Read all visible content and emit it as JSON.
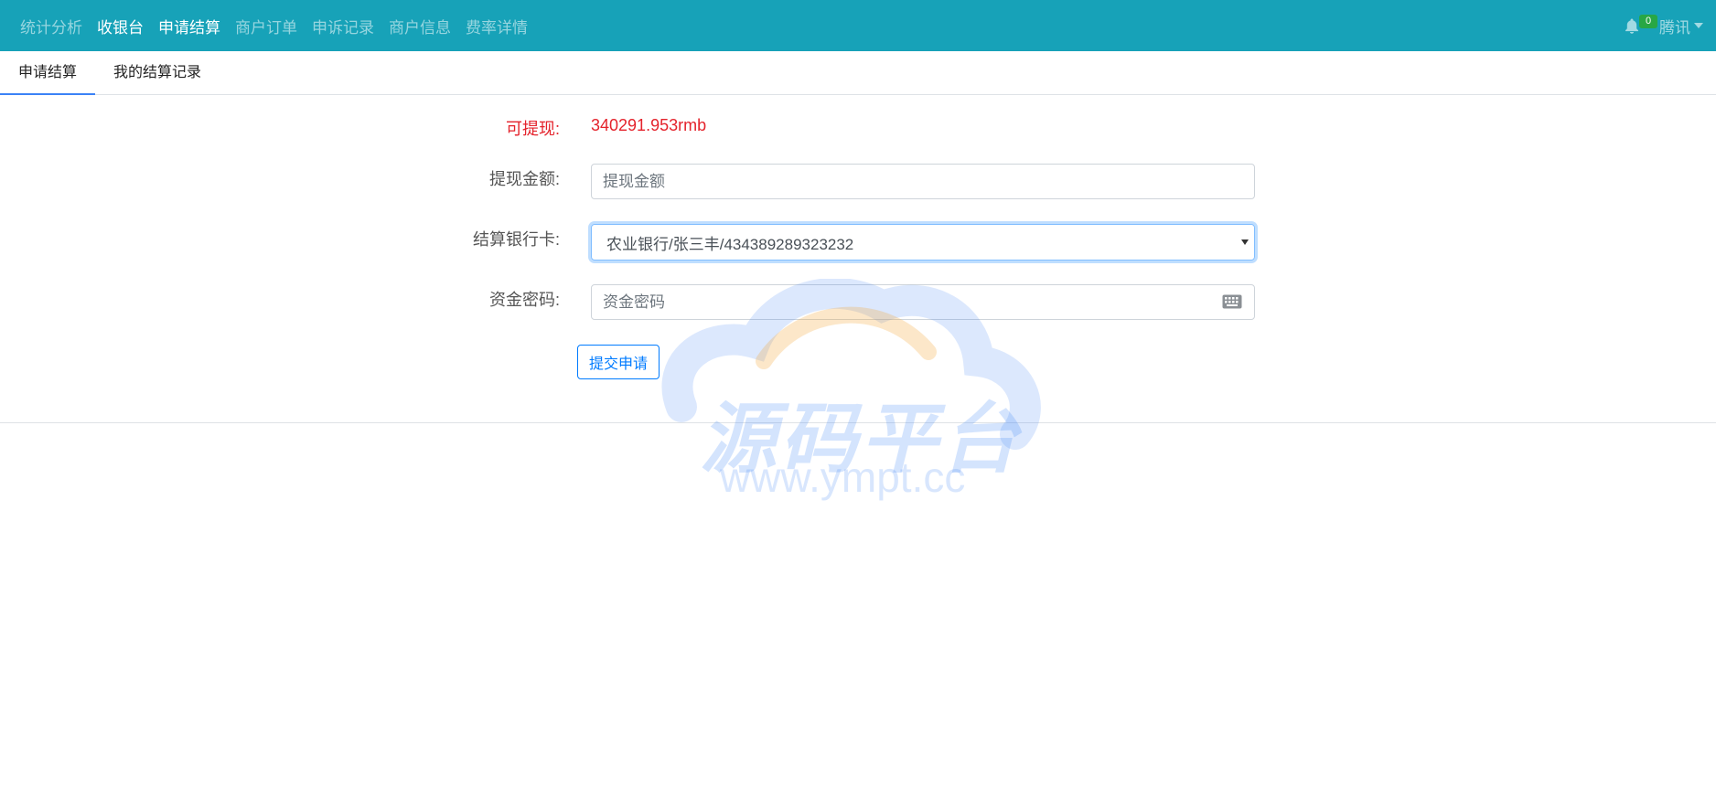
{
  "nav": {
    "items": [
      {
        "label": "统计分析"
      },
      {
        "label": "收银台"
      },
      {
        "label": "申请结算"
      },
      {
        "label": "商户订单"
      },
      {
        "label": "申诉记录"
      },
      {
        "label": "商户信息"
      },
      {
        "label": "费率详情"
      }
    ],
    "notification_count": "0",
    "user": "腾讯"
  },
  "tabs": [
    {
      "label": "申请结算"
    },
    {
      "label": "我的结算记录"
    }
  ],
  "form": {
    "available_label": "可提现:",
    "available_value": "340291.953rmb",
    "amount_label": "提现金额:",
    "amount_placeholder": "提现金额",
    "bank_label": "结算银行卡:",
    "bank_value": "农业银行/张三丰/434389289323232",
    "password_label": "资金密码:",
    "password_placeholder": "资金密码",
    "submit_label": "提交申请"
  },
  "watermark": {
    "title": "源码平台",
    "url": "www.ympt.cc"
  },
  "colors": {
    "navbar": "#17a2b8",
    "accent": "#007bff",
    "danger": "#e4222b",
    "badge": "#28a745"
  }
}
